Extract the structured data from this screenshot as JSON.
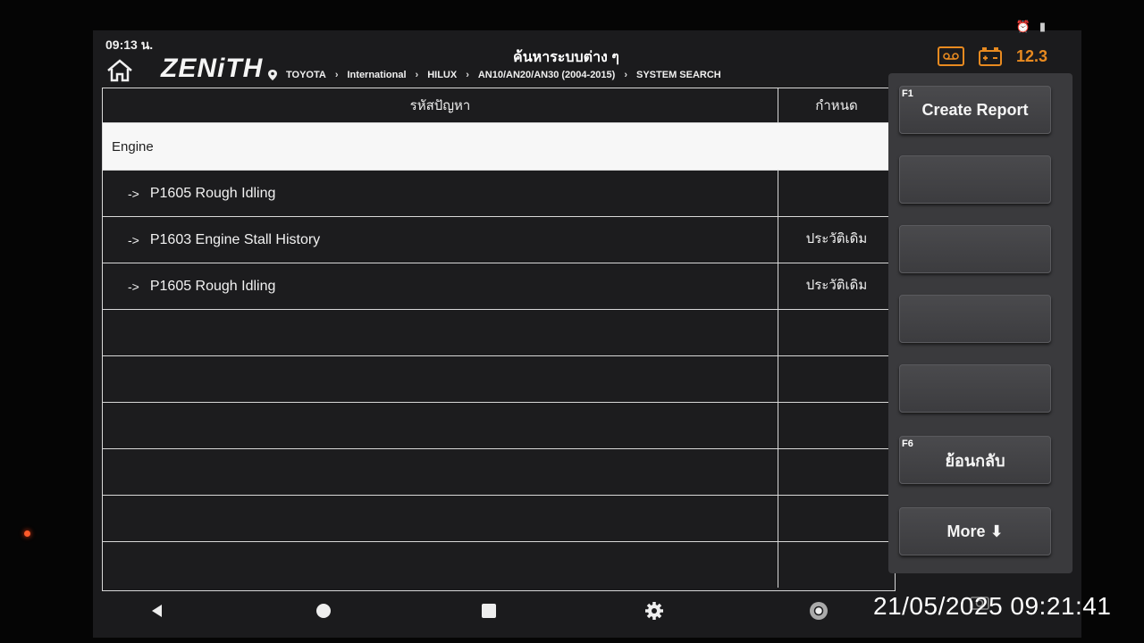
{
  "status": {
    "time": "09:13 น."
  },
  "header": {
    "logo": "ZENiTH",
    "title": "ค้นหาระบบต่าง ๆ",
    "breadcrumb": [
      "TOYOTA",
      "International",
      "HILUX",
      "AN10/AN20/AN30 (2004-2015)",
      "SYSTEM SEARCH"
    ],
    "voltage": "12.3",
    "accent_color": "#e88a20"
  },
  "table": {
    "columns": [
      "รหัสปัญหา",
      "กำหนด"
    ],
    "group": "Engine",
    "rows": [
      {
        "arrow": "->",
        "code": "P1605 Rough Idling",
        "def": ""
      },
      {
        "arrow": "->",
        "code": "P1603 Engine Stall History",
        "def": "ประวัติเดิม"
      },
      {
        "arrow": "->",
        "code": "P1605 Rough Idling",
        "def": "ประวัติเดิม"
      }
    ]
  },
  "side": {
    "f1_key": "F1",
    "create_report": "Create Report",
    "f6_key": "F6",
    "back": "ย้อนกลับ",
    "more": "More ⬇"
  },
  "overlay": {
    "timestamp": "21/05/2025 09:21:41"
  }
}
